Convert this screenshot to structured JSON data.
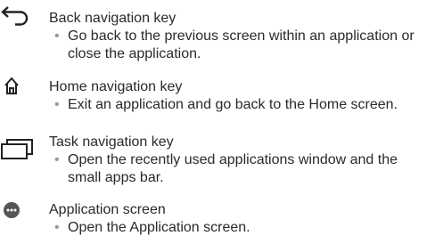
{
  "items": [
    {
      "icon": "back-arrow-icon",
      "title": "Back navigation key",
      "description": "Go back to the previous screen within an application or close the application."
    },
    {
      "icon": "home-icon",
      "title": "Home navigation key",
      "description": "Exit an application and go back to the Home screen."
    },
    {
      "icon": "recent-apps-icon",
      "title": "Task navigation key",
      "description": "Open the recently used applications window and the small apps bar."
    },
    {
      "icon": "apps-grid-icon",
      "title": "Application screen",
      "description": "Open the Application screen."
    }
  ],
  "bullet": "•",
  "colors": {
    "text": "#2a2a2a",
    "bullet": "#9a9a9a",
    "icon": "#222222"
  }
}
